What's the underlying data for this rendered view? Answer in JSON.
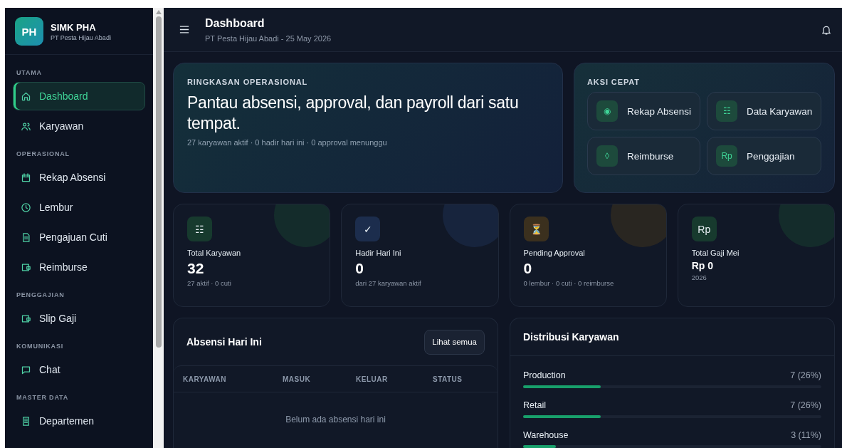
{
  "brand": {
    "logo": "PH",
    "name": "SIMK PHA",
    "company": "PT Pesta Hijau Abadi"
  },
  "sidebar": {
    "sections": [
      {
        "title": "UTAMA",
        "items": [
          {
            "label": "Dashboard",
            "selected": true
          },
          {
            "label": "Karyawan",
            "selected": false
          }
        ]
      },
      {
        "title": "OPERASIONAL",
        "items": [
          {
            "label": "Rekap Absensi",
            "selected": false
          },
          {
            "label": "Lembur",
            "selected": false
          },
          {
            "label": "Pengajuan Cuti",
            "selected": false
          },
          {
            "label": "Reimburse",
            "selected": false
          }
        ]
      },
      {
        "title": "PENGGAJIAN",
        "items": [
          {
            "label": "Slip Gaji",
            "selected": false
          }
        ]
      },
      {
        "title": "KOMUNIKASI",
        "items": [
          {
            "label": "Chat",
            "selected": false
          }
        ]
      },
      {
        "title": "MASTER DATA",
        "items": [
          {
            "label": "Departemen",
            "selected": false
          }
        ]
      }
    ]
  },
  "header": {
    "title": "Dashboard",
    "subtitle": "PT Pesta Hijau Abadi - 25 May 2026"
  },
  "summary": {
    "eyebrow": "RINGKASAN OPERASIONAL",
    "headline": "Pantau absensi, approval, dan payroll dari satu tempat.",
    "detail": "27 karyawan aktif · 0 hadir hari ini · 0 approval menunggu"
  },
  "quick_actions": {
    "title": "AKSI CEPAT",
    "items": [
      {
        "icon": "◉",
        "label": "Rekap Absensi"
      },
      {
        "icon": "☷",
        "label": "Data Karyawan"
      },
      {
        "icon": "◊",
        "label": "Reimburse"
      },
      {
        "icon": "Rp",
        "label": "Penggajian"
      }
    ]
  },
  "stats": [
    {
      "icon": "☷",
      "label": "Total Karyawan",
      "value": "32",
      "note": "27 aktif · 0 cuti",
      "color": "#173a2e"
    },
    {
      "icon": "✓",
      "label": "Hadir Hari Ini",
      "value": "0",
      "note": "dari 27 karyawan aktif",
      "color": "#1c2d4d"
    },
    {
      "icon": "⏳",
      "label": "Pending Approval",
      "value": "0",
      "note": "0 lembur · 0 cuti · 0 reimburse",
      "color": "#3b301e"
    },
    {
      "icon": "Rp",
      "label": "Total Gaji Mei",
      "value": "Rp 0",
      "note": "2026",
      "color": "#173a2e"
    }
  ],
  "attendance": {
    "title": "Absensi Hari Ini",
    "button": "Lihat semua",
    "columns": [
      "KARYAWAN",
      "MASUK",
      "KELUAR",
      "STATUS"
    ],
    "empty": "Belum ada absensi hari ini"
  },
  "distribution": {
    "title": "Distribusi Karyawan",
    "rows": [
      {
        "name": "Production",
        "reading": "7 (26%)",
        "level": 0.26
      },
      {
        "name": "Retail",
        "reading": "7 (26%)",
        "level": 0.26
      },
      {
        "name": "Warehouse",
        "reading": "3 (11%)",
        "level": 0.11
      }
    ]
  }
}
